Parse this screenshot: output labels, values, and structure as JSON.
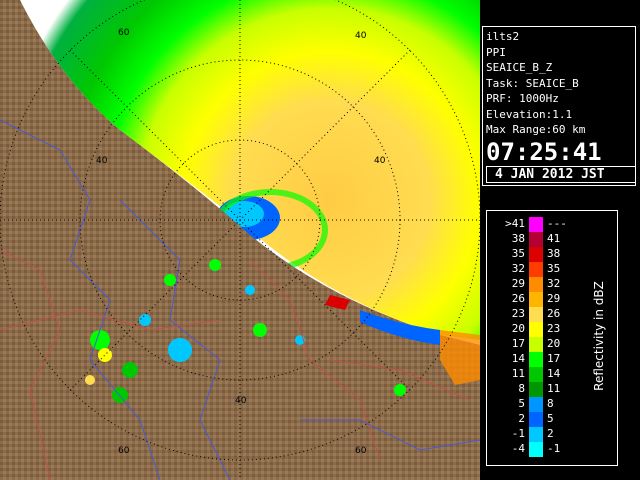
{
  "info": {
    "radar_name": "ilts2",
    "scan_type": "PPI",
    "product": "SEAICE_B_Z",
    "task": "Task: SEAICE_B",
    "prf": "PRF: 1000Hz",
    "elevation": "Elevation:1.1",
    "max_range": "Max Range:60 km",
    "time": "07:25:41",
    "date": "4 JAN 2012 JST"
  },
  "legend": {
    "title": "Reflectivity in dBZ",
    "rows": [
      {
        "lo": ">41",
        "hi": "---",
        "color": "#ff00ff"
      },
      {
        "lo": "38",
        "hi": "41",
        "color": "#b40032"
      },
      {
        "lo": "35",
        "hi": "38",
        "color": "#dc0000"
      },
      {
        "lo": "32",
        "hi": "35",
        "color": "#ff3c00"
      },
      {
        "lo": "29",
        "hi": "32",
        "color": "#ff8c00"
      },
      {
        "lo": "26",
        "hi": "29",
        "color": "#ffb400"
      },
      {
        "lo": "23",
        "hi": "26",
        "color": "#ffdc50"
      },
      {
        "lo": "20",
        "hi": "23",
        "color": "#ffff00"
      },
      {
        "lo": "17",
        "hi": "20",
        "color": "#c8ff00"
      },
      {
        "lo": "14",
        "hi": "17",
        "color": "#00ff00"
      },
      {
        "lo": "11",
        "hi": "14",
        "color": "#00c800"
      },
      {
        "lo": "8",
        "hi": "11",
        "color": "#009600"
      },
      {
        "lo": "5",
        "hi": "8",
        "color": "#0096ff"
      },
      {
        "lo": "2",
        "hi": "5",
        "color": "#0064ff"
      },
      {
        "lo": "-1",
        "hi": "2",
        "color": "#00c8ff"
      },
      {
        "lo": "-4",
        "hi": "-1",
        "color": "#00ffff"
      }
    ]
  },
  "map": {
    "range_labels": [
      "60",
      "40",
      "40",
      "40",
      "40",
      "60",
      "60"
    ],
    "colors": {
      "land": "#8b6b4a",
      "land_dark": "#5e4630",
      "no_echo": "#ffffff",
      "ring": "#000000",
      "boundary_blue": "#4a5ad0",
      "boundary_red": "#c0504a"
    }
  }
}
